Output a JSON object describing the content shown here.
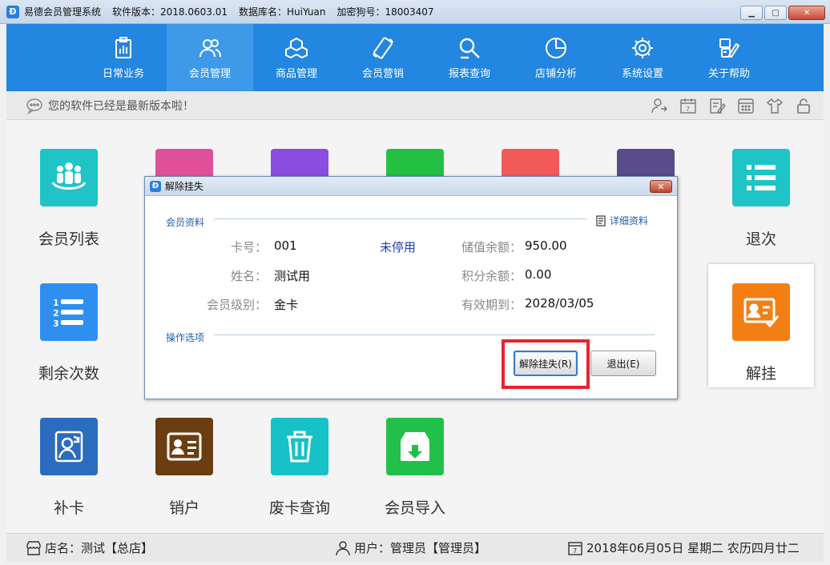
{
  "window": {
    "app_name": "易德会员管理系统",
    "version": "软件版本：2018.0603.01",
    "database": "数据库名：HuiYuan",
    "dongle": "加密狗号：18003407",
    "icon_letter": "Đ"
  },
  "nav": {
    "items": [
      {
        "label": "日常业务",
        "icon": "clipboard-icon"
      },
      {
        "label": "会员管理",
        "icon": "members-icon",
        "active": true
      },
      {
        "label": "商品管理",
        "icon": "boxes-icon"
      },
      {
        "label": "会员营销",
        "icon": "phone-icon"
      },
      {
        "label": "报表查询",
        "icon": "search-report-icon"
      },
      {
        "label": "店铺分析",
        "icon": "pie-chart-icon"
      },
      {
        "label": "系统设置",
        "icon": "gear-icon"
      },
      {
        "label": "关于帮助",
        "icon": "help-icon"
      }
    ]
  },
  "notice": {
    "text": "您的软件已经是最新版本啦！"
  },
  "tiles": [
    {
      "label": "会员列表",
      "color": "#1fc4c7"
    },
    {
      "label": "剩余次数",
      "color": "#2f8ff0"
    },
    {
      "label": "补卡",
      "color": "#2b6cbf"
    },
    {
      "label": "销户",
      "color": "#6b3e12"
    },
    {
      "label": "废卡查询",
      "color": "#16c2c8"
    },
    {
      "label": "会员导入",
      "color": "#22c04a"
    },
    {
      "label": "退次",
      "color": "#1fc4c7"
    },
    {
      "label": "解挂",
      "color": "#f37f14"
    }
  ],
  "hidden_tile_colors": [
    "#e0509a",
    "#8a4de0",
    "#23c044",
    "#f25a5a",
    "#5a4c8a"
  ],
  "dialog": {
    "title": "解除挂失",
    "section_member": "会员资料",
    "detail_link": "详细资料",
    "card_label": "卡号：",
    "card_value": "001",
    "card_status": "未停用",
    "name_label": "姓名：",
    "name_value": "测试用",
    "level_label": "会员级别：",
    "level_value": "金卡",
    "balance_label": "储值余额：",
    "balance_value": "950.00",
    "points_label": "积分余额：",
    "points_value": "0.00",
    "expiry_label": "有效期到：",
    "expiry_value": "2028/03/05",
    "section_ops": "操作选项",
    "unlock_button": "解除挂失(R)",
    "exit_button": "退出(E)"
  },
  "statusbar": {
    "store": "店名：测试【总店】",
    "user": "用户：管理员【管理员】",
    "date": "2018年06月05日 星期二 农历四月廿二"
  }
}
